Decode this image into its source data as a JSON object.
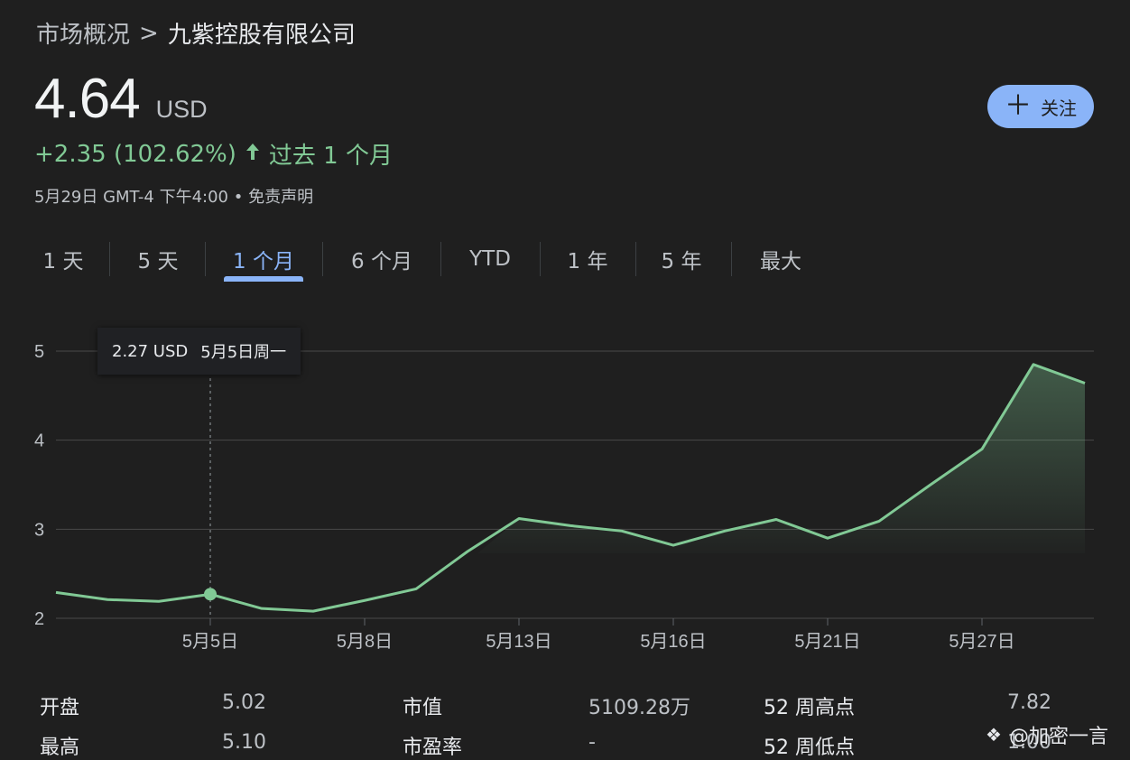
{
  "breadcrumb": {
    "root": "市场概况",
    "separator": ">",
    "current": "九紫控股有限公司"
  },
  "quote": {
    "price": "4.64",
    "currency": "USD",
    "change": "+2.35 (102.62%)",
    "change_period": "过去 1 个月",
    "timestamp": "5月29日 GMT-4 下午4:00",
    "bullet": "•",
    "disclaimer": "免责声明"
  },
  "follow_button": {
    "icon": "plus-icon",
    "label": "关注"
  },
  "tabs": [
    {
      "label": "1 天",
      "active": false
    },
    {
      "label": "5 天",
      "active": false
    },
    {
      "label": "1 个月",
      "active": true
    },
    {
      "label": "6 个月",
      "active": false
    },
    {
      "label": "YTD",
      "active": false
    },
    {
      "label": "1 年",
      "active": false
    },
    {
      "label": "5 年",
      "active": false
    },
    {
      "label": "最大",
      "active": false
    }
  ],
  "tooltip": {
    "value": "2.27 USD",
    "date": "5月5日周一"
  },
  "colors": {
    "accent": "#8ab4f8",
    "up": "#81c995",
    "background": "#1f1f1f"
  },
  "chart_data": {
    "type": "line",
    "y_ticks": [
      "2",
      "3",
      "4",
      "5"
    ],
    "ylim": [
      2,
      5
    ],
    "x_tick_labels": [
      "5月5日",
      "5月8日",
      "5月13日",
      "5月16日",
      "5月21日",
      "5月27日"
    ],
    "baseline": 2.73,
    "hover_point": {
      "date": "5月5日",
      "value": 2.27
    },
    "series": [
      {
        "points": [
          {
            "date": "4月30日",
            "value": 2.29
          },
          {
            "date": "5月1日",
            "value": 2.21
          },
          {
            "date": "5月2日",
            "value": 2.19
          },
          {
            "date": "5月5日",
            "value": 2.27
          },
          {
            "date": "5月6日",
            "value": 2.11
          },
          {
            "date": "5月7日",
            "value": 2.08
          },
          {
            "date": "5月8日",
            "value": 2.2
          },
          {
            "date": "5月9日",
            "value": 2.33
          },
          {
            "date": "5月12日",
            "value": 2.75
          },
          {
            "date": "5月13日",
            "value": 3.12
          },
          {
            "date": "5月14日",
            "value": 3.04
          },
          {
            "date": "5月15日",
            "value": 2.98
          },
          {
            "date": "5月16日",
            "value": 2.82
          },
          {
            "date": "5月19日",
            "value": 2.98
          },
          {
            "date": "5月20日",
            "value": 3.11
          },
          {
            "date": "5月21日",
            "value": 2.9
          },
          {
            "date": "5月22日",
            "value": 3.09
          },
          {
            "date": "5月23日",
            "value": 3.5
          },
          {
            "date": "5月27日",
            "value": 3.9
          },
          {
            "date": "5月28日",
            "value": 4.85
          },
          {
            "date": "5月29日",
            "value": 4.64
          }
        ]
      }
    ]
  },
  "stats": [
    {
      "label": "开盘",
      "value": "5.02"
    },
    {
      "label": "最高",
      "value": "5.10"
    },
    {
      "label": "市值",
      "value": "5109.28万"
    },
    {
      "label": "市盈率",
      "value": "-"
    },
    {
      "label": "52 周高点",
      "value": "7.82"
    },
    {
      "label": "52 周低点",
      "value": "1.00"
    }
  ],
  "watermark": {
    "text": "@加密一言"
  }
}
